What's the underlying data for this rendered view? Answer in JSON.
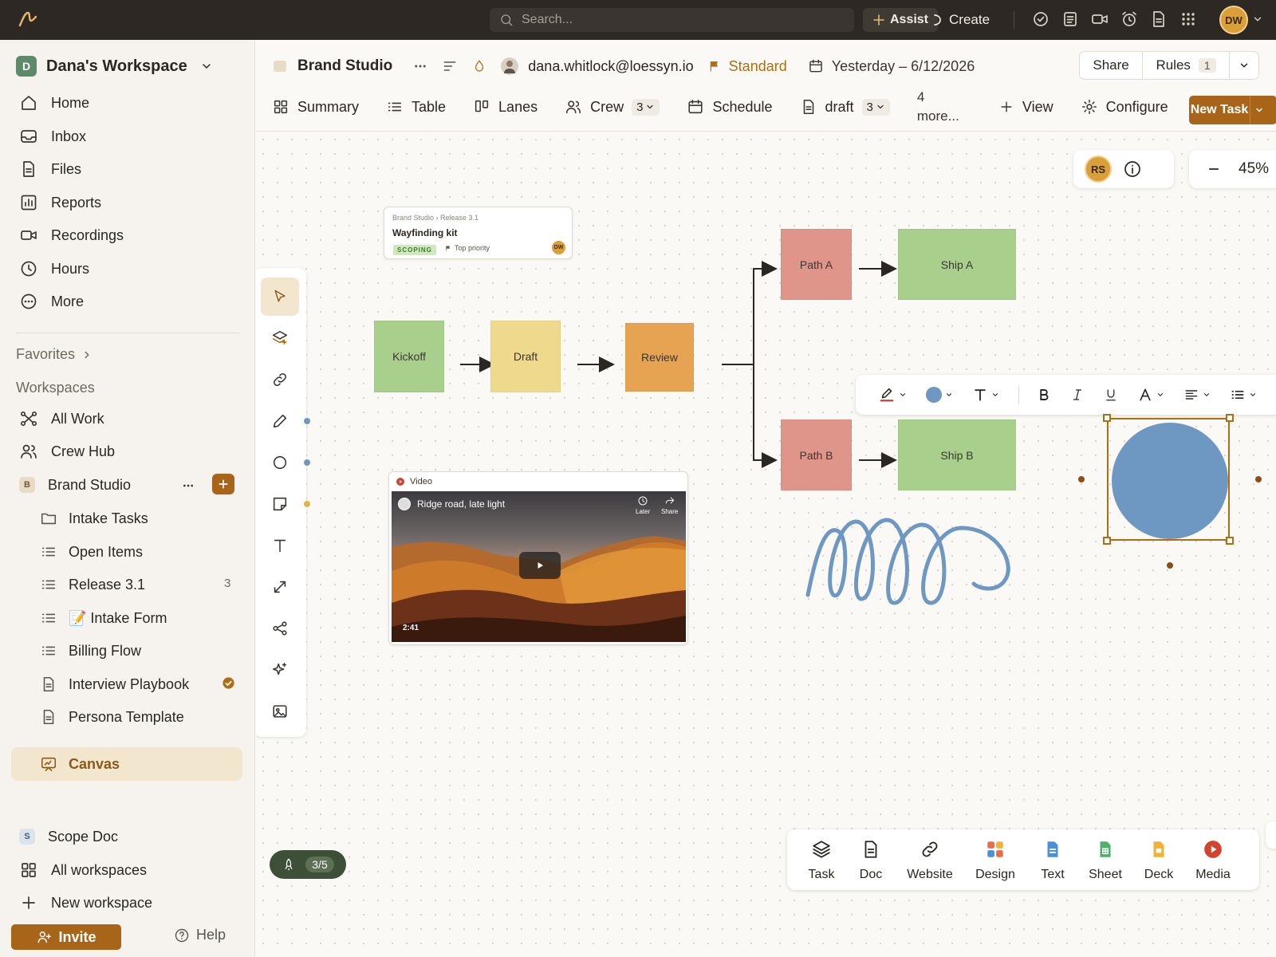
{
  "topbar": {
    "search_placeholder": "Search...",
    "assist_label": "Assist",
    "create_label": "Create",
    "user_initials": "DW",
    "icons": [
      "check-circle-icon",
      "notes-icon",
      "video-icon",
      "alarm-icon",
      "doc-icon",
      "apps-grid-icon"
    ]
  },
  "sidebar": {
    "workspace_initial": "D",
    "workspace_name": "Dana's Workspace",
    "nav": [
      {
        "label": "Home",
        "icon": "home-icon"
      },
      {
        "label": "Inbox",
        "icon": "inbox-icon"
      },
      {
        "label": "Files",
        "icon": "file-icon"
      },
      {
        "label": "Reports",
        "icon": "chart-icon"
      },
      {
        "label": "Recordings",
        "icon": "camera-icon"
      },
      {
        "label": "Hours",
        "icon": "clock-icon"
      },
      {
        "label": "More",
        "icon": "more-circle-icon"
      }
    ],
    "favorites_label": "Favorites",
    "workspaces_label": "Workspaces",
    "all_work_label": "All Work",
    "crew_hub_label": "Crew Hub",
    "brand_studio": {
      "initial": "B",
      "label": "Brand Studio"
    },
    "tree": [
      {
        "label": "Intake Tasks",
        "icon": "folder-icon"
      },
      {
        "label": "Open Items",
        "icon": "list-icon"
      },
      {
        "label": "Release 3.1",
        "icon": "list-icon",
        "count": "3"
      },
      {
        "label": "📝 Intake Form",
        "icon": "list-icon"
      },
      {
        "label": "Billing Flow",
        "icon": "list-icon"
      },
      {
        "label": "Interview Playbook",
        "icon": "doc-icon"
      },
      {
        "label": "Persona Template",
        "icon": "doc-icon"
      },
      {
        "label": "Canvas",
        "icon": "canvas-icon"
      }
    ],
    "scope_doc": {
      "initial": "S",
      "label": "Scope Doc"
    },
    "all_workspaces_label": "All workspaces",
    "new_workspace_label": "New workspace",
    "invite_label": "Invite",
    "help_label": "Help"
  },
  "header": {
    "title": "Brand Studio",
    "owner_email": "dana.whitlock@loessyn.io",
    "priority": "Standard",
    "date_range": "Yesterday – 6/12/2026",
    "share_label": "Share",
    "rules_label": "Rules",
    "rules_count": "1",
    "tabs": [
      {
        "label": "Summary",
        "icon": "grid-icon"
      },
      {
        "label": "Table",
        "icon": "list-icon"
      },
      {
        "label": "Lanes",
        "icon": "board-icon"
      },
      {
        "label": "Crew",
        "icon": "people-icon",
        "count": "3"
      },
      {
        "label": "Schedule",
        "icon": "calendar-icon"
      },
      {
        "label": "draft",
        "icon": "doc-icon",
        "count": "3"
      }
    ],
    "more_tabs": "4 more...",
    "add_view_label": "View",
    "configure_label": "Configure",
    "new_task_label": "New Task"
  },
  "canvas": {
    "collaborator_initials": "RS",
    "zoom": "45%",
    "task_card": {
      "breadcrumb": "Brand Studio › Release 3.1",
      "title": "Wayfinding kit",
      "status": "SCOPING",
      "priority": "Top priority",
      "assignee": "DW"
    },
    "nodes": {
      "kickoff": "Kickoff",
      "draft": "Draft",
      "review": "Review",
      "path_a": "Path A",
      "ship_a": "Ship A",
      "path_b": "Path B",
      "ship_b": "Ship B"
    },
    "colors": {
      "green": "#a9cf8c",
      "yellow": "#efd98c",
      "orange": "#e6a352",
      "red": "#e0958b",
      "circle": "#6e98c2",
      "accent": "#a86418"
    },
    "video": {
      "label": "Video",
      "title": "Ridge road, late light",
      "later": "Later",
      "share": "Share",
      "duration": "2:41"
    },
    "progress": "3/5",
    "insert": [
      {
        "label": "Task",
        "icon": "stack-icon"
      },
      {
        "label": "Doc",
        "icon": "doc-icon"
      },
      {
        "label": "Website",
        "icon": "link-icon"
      },
      {
        "label": "Design",
        "icon": "design-icon"
      },
      {
        "label": "Text",
        "icon": "text-doc-icon"
      },
      {
        "label": "Sheet",
        "icon": "sheet-icon"
      },
      {
        "label": "Deck",
        "icon": "deck-icon"
      },
      {
        "label": "Media",
        "icon": "media-play-icon"
      }
    ]
  }
}
